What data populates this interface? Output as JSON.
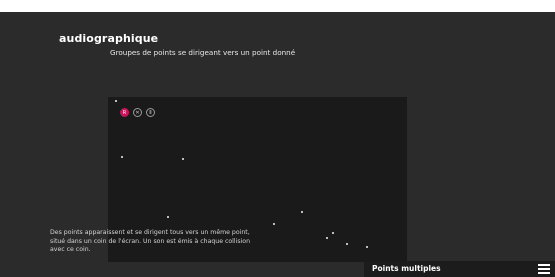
{
  "app": {
    "title": "audiographique",
    "subtitle": "Groupes de points se dirigeant vers un point donné"
  },
  "controls": {
    "sound_label": "R",
    "close_label": "✕",
    "pause_label": "Ⅱ"
  },
  "description": "Des points apparaissent et se dirigent tous vers un même point, situé dans un coin de l'écran. Un son est émis à chaque collision avec ce coin.",
  "footer": {
    "mode_label": "Points multiples"
  },
  "colors": {
    "page_background": "#2b2b2b",
    "canvas_background": "#1a1a1a",
    "accent": "#c2185b",
    "dot": "#f2f2f2"
  },
  "icons": {
    "sound": "sound-toggle-icon",
    "close": "close-icon",
    "pause": "pause-icon",
    "menu": "hamburger-menu-icon"
  }
}
